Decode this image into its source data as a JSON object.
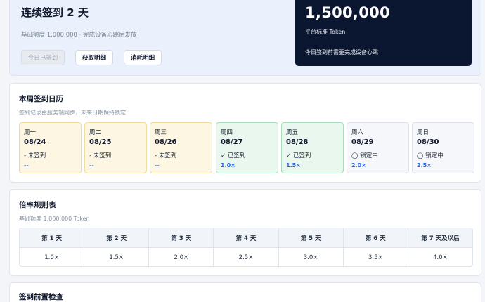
{
  "hero": {
    "title": "连续签到 2 天",
    "subtitle": "基础额度 1,000,000 · 完成设备心跳后发放",
    "buttons": {
      "signed": "今日已签到",
      "earn_detail": "获取明细",
      "spend_detail": "消耗明细"
    }
  },
  "token": {
    "amount": "1,500,000",
    "label": "平台标准 Token",
    "note": "今日签到前需要完成设备心跳"
  },
  "calendar": {
    "title": "本周签到日历",
    "subtitle": "签到记录由服务端同步，未来日期保持锁定",
    "days": [
      {
        "name": "周一",
        "date": "08/24",
        "status": "- 未签到",
        "mult": "--",
        "state": "missed"
      },
      {
        "name": "周二",
        "date": "08/25",
        "status": "- 未签到",
        "mult": "--",
        "state": "missed"
      },
      {
        "name": "周三",
        "date": "08/26",
        "status": "- 未签到",
        "mult": "--",
        "state": "missed"
      },
      {
        "name": "周四",
        "date": "08/27",
        "status": "✓ 已签到",
        "mult": "1.0×",
        "state": "signed"
      },
      {
        "name": "周五",
        "date": "08/28",
        "status": "✓ 已签到",
        "mult": "1.5×",
        "state": "signed"
      },
      {
        "name": "周六",
        "date": "08/29",
        "status": "◯ 锁定中",
        "mult": "2.0×",
        "state": "locked"
      },
      {
        "name": "周日",
        "date": "08/30",
        "status": "◯ 锁定中",
        "mult": "2.5×",
        "state": "locked"
      }
    ]
  },
  "rules": {
    "title": "倍率规则表",
    "subtitle": "基础额度 1,000,000 Token",
    "headers": [
      "第 1 天",
      "第 2 天",
      "第 3 天",
      "第 4 天",
      "第 5 天",
      "第 6 天",
      "第 7 天及以后"
    ],
    "values": [
      "1.0×",
      "1.5×",
      "2.0×",
      "2.5×",
      "3.0×",
      "3.5×",
      "4.0×"
    ]
  },
  "precheck": {
    "title": "签到前置检查"
  },
  "colors": {
    "accent": "#2563eb",
    "token_card": "#0b1730",
    "signed_bg": "#e9f7ef",
    "missed_bg": "#fdf6e2"
  }
}
